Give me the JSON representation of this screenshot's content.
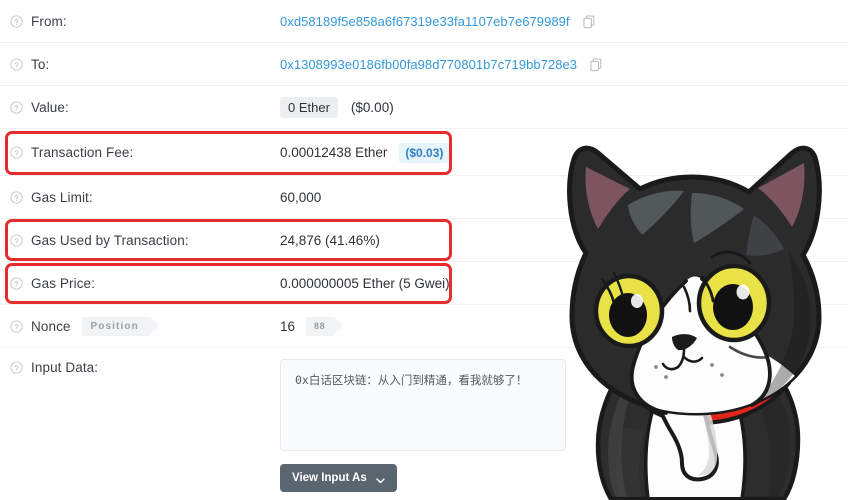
{
  "rows": [
    {
      "label": "From:",
      "value": "0xd58189f5e858a6f67319e33fa1107eb7e679989f",
      "type": "address",
      "copy_icon": "copy-icon"
    },
    {
      "label": "To:",
      "value": "0x1308993e0186fb00fa98d770801b7c719bb728e3",
      "type": "address",
      "copy_icon": "copy-icon"
    },
    {
      "label": "Value:",
      "value": "0 Ether",
      "secondary": "($0.00)",
      "type": "pill"
    },
    {
      "label": "Transaction Fee:",
      "value": "0.00012438 Ether",
      "secondary": "($0.03)",
      "type": "fee",
      "highlighted": true
    },
    {
      "label": "Gas Limit:",
      "value": "60,000",
      "type": "plain"
    },
    {
      "label": "Gas Used by Transaction:",
      "value": "24,876 (41.46%)",
      "type": "plain",
      "highlighted": true
    },
    {
      "label": "Gas Price:",
      "value": "0.000000005 Ether (5 Gwei)",
      "type": "plain",
      "highlighted": true
    },
    {
      "label": "Nonce",
      "badge": "Position",
      "value": "16",
      "value_badge": "88",
      "type": "nonce"
    },
    {
      "label": "Input Data:",
      "type": "input"
    }
  ],
  "input_data": {
    "text": "0x白话区块链：从入门到精通，看我就够了！",
    "button_label": "View Input As",
    "button_caret": "chevron-down-icon"
  },
  "icons": {
    "help": "question-mark-circle-icon",
    "copy": "copy-icon",
    "caret": "chevron-down-icon"
  },
  "mascot": {
    "name": "tuxedo-cat-mascot",
    "eye_color": "#e8e246",
    "collar_color": "#e1251b",
    "body_color": "#2b2b2b"
  },
  "colors": {
    "link": "#3498db",
    "highlight_box": "#e82c2c",
    "usd_badge_bg": "#e8f4fb",
    "usd_badge_text": "#2f80c4",
    "pill_bg": "#eceef0",
    "button_bg": "#5a6570",
    "separator": "#f0f1f3"
  }
}
